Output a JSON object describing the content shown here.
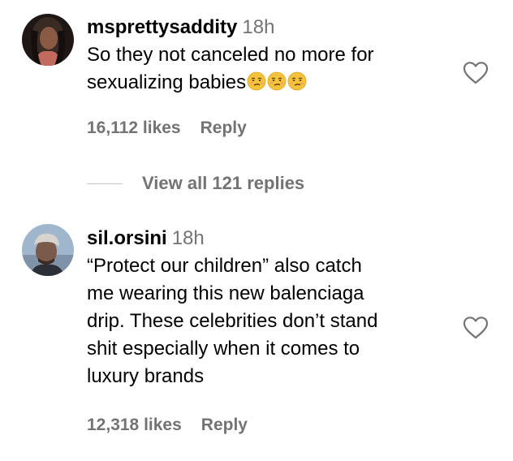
{
  "comments": [
    {
      "username": "msprettysaddity",
      "time": "18h",
      "text_lines": [
        "So they not canceled no more for",
        "sexualizing babies"
      ],
      "emojis": [
        "smirk-emoji",
        "smirk-emoji",
        "smirk-emoji"
      ],
      "likes": "16,112 likes",
      "reply_label": "Reply"
    },
    {
      "username": "sil.orsini",
      "time": "18h",
      "text_lines": [
        "“Protect our children” also catch",
        "me wearing this new balenciaga",
        "drip. These celebrities don’t stand",
        "shit especially when it comes to",
        "luxury brands"
      ],
      "likes": "12,318 likes",
      "reply_label": "Reply"
    }
  ],
  "view_replies": {
    "label": "View all 121 replies"
  },
  "icons": {
    "heart": "heart-outline-icon",
    "emoji": "smirk-emoji"
  },
  "colors": {
    "secondary_text": "#737373",
    "divider": "#c7c7c7",
    "emoji": "#f5c33b"
  }
}
